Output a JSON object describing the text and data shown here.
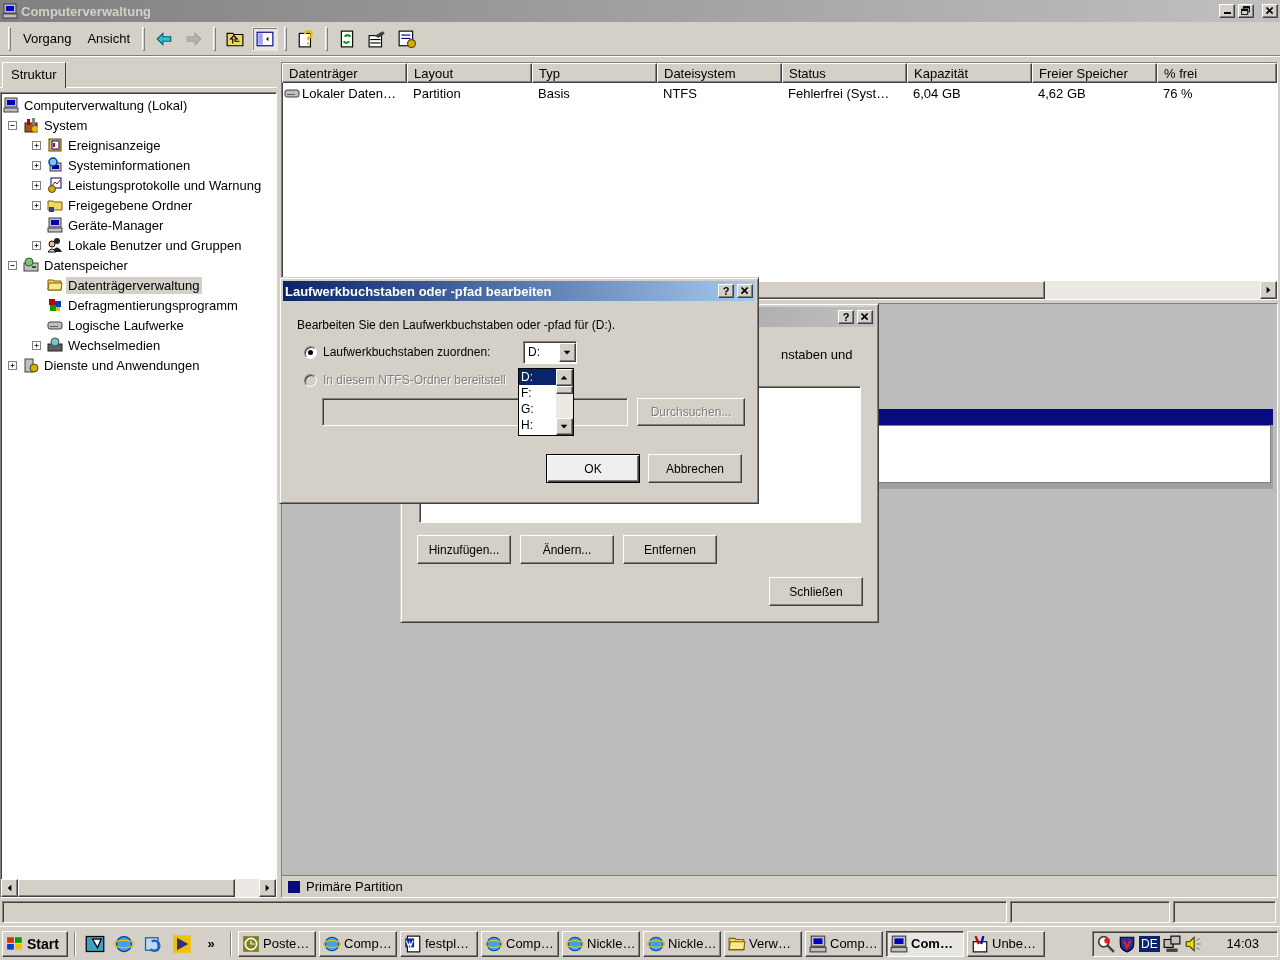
{
  "window": {
    "title": "Computerverwaltung"
  },
  "menu": [
    "Vorgang",
    "Ansicht"
  ],
  "toolbar_groups": [
    [
      {
        "kind": "back",
        "disabled": false,
        "pressed": false
      },
      {
        "kind": "forward",
        "disabled": true,
        "pressed": false
      }
    ],
    [
      {
        "kind": "up",
        "disabled": false,
        "pressed": false
      },
      {
        "kind": "tree",
        "disabled": false,
        "pressed": true
      }
    ],
    [
      {
        "kind": "help",
        "disabled": false,
        "pressed": false
      }
    ],
    [
      {
        "kind": "refresh",
        "disabled": false,
        "pressed": false
      },
      {
        "kind": "properties",
        "disabled": false,
        "pressed": false
      },
      {
        "kind": "export",
        "disabled": false,
        "pressed": false
      }
    ]
  ],
  "tabs": [
    {
      "label": "Struktur",
      "selected": true
    }
  ],
  "tree": [
    {
      "label": "Computerverwaltung (Lokal)",
      "kind": "computer",
      "selected": false,
      "children": [
        {
          "label": "System",
          "kind": "tools",
          "expanded": true,
          "selected": false,
          "children": [
            {
              "label": "Ereignisanzeige",
              "kind": "eventlog",
              "expanded": false,
              "selected": false
            },
            {
              "label": "Systeminformationen",
              "kind": "sysinfo",
              "expanded": false,
              "selected": false
            },
            {
              "label": "Leistungsprotokolle und Warnung",
              "kind": "perf",
              "expanded": false,
              "selected": false
            },
            {
              "label": "Freigegebene Ordner",
              "kind": "shared",
              "expanded": false,
              "selected": false
            },
            {
              "label": "Geräte-Manager",
              "kind": "computer",
              "selected": false
            },
            {
              "label": "Lokale Benutzer und Gruppen",
              "kind": "users",
              "expanded": false,
              "selected": false
            }
          ]
        },
        {
          "label": "Datenspeicher",
          "kind": "storage",
          "expanded": true,
          "selected": false,
          "children": [
            {
              "label": "Datenträgerverwaltung",
              "kind": "folder",
              "selected": true
            },
            {
              "label": "Defragmentierungsprogramm",
              "kind": "defrag",
              "selected": false
            },
            {
              "label": "Logische Laufwerke",
              "kind": "drive",
              "selected": false
            },
            {
              "label": "Wechselmedien",
              "kind": "media",
              "expanded": false,
              "selected": false
            }
          ]
        },
        {
          "label": "Dienste und Anwendungen",
          "kind": "services",
          "expanded": false,
          "selected": false
        }
      ]
    }
  ],
  "table": {
    "columns": [
      "Datenträger",
      "Layout",
      "Typ",
      "Dateisystem",
      "Status",
      "Kapazität",
      "Freier Speicher",
      "% frei"
    ],
    "rows": [
      {
        "cells": [
          "Lokaler Daten…",
          "Partition",
          "Basis",
          "NTFS",
          "Fehlerfrei (Syst…",
          "6,04 GB",
          "4,62 GB",
          "76 %"
        ]
      }
    ]
  },
  "legend": [
    {
      "label": "Primäre Partition",
      "color": "#0a0a80"
    }
  ],
  "back_dialog": {
    "help_glyph": "?",
    "text_fragment": "nstaben und",
    "buttons": [
      "Hinzufügen...",
      "Ändern...",
      "Entfernen"
    ],
    "close_button": "Schließen"
  },
  "dialog": {
    "title": "Laufwerkbuchstaben oder -pfad bearbeiten",
    "help_glyph": "?",
    "prompt": "Bearbeiten Sie den Laufwerkbuchstaben oder -pfad für  (D:).",
    "options": [
      {
        "label": "Laufwerkbuchstaben zuordnen:",
        "selected": true,
        "disabled": false
      },
      {
        "label": "In diesem NTFS-Ordner bereitstell",
        "selected": false,
        "disabled": true
      }
    ],
    "drive_value": "D:",
    "drive_list": [
      {
        "label": "D:",
        "selected": true
      },
      {
        "label": "F:",
        "selected": false
      },
      {
        "label": "G:",
        "selected": false
      },
      {
        "label": "H:",
        "selected": false
      }
    ],
    "browse_button": {
      "label": "Durchsuchen...",
      "disabled": true
    },
    "buttons": [
      {
        "label": "OK",
        "default": true
      },
      {
        "label": "Abbrechen",
        "default": false
      }
    ]
  },
  "taskbar": {
    "start": "Start",
    "more": "»",
    "tasks": [
      {
        "label": "Poste…",
        "kind": "clock",
        "selected": false
      },
      {
        "label": "Comp…",
        "kind": "ie",
        "selected": false
      },
      {
        "label": "festpl…",
        "kind": "word",
        "selected": false
      },
      {
        "label": "Comp…",
        "kind": "ie",
        "selected": false
      },
      {
        "label": "Nickle…",
        "kind": "ie",
        "selected": false
      },
      {
        "label": "Nickle…",
        "kind": "ie",
        "selected": false
      },
      {
        "label": "Verw…",
        "kind": "folder",
        "selected": false
      },
      {
        "label": "Comp…",
        "kind": "computer",
        "selected": false
      },
      {
        "label": "Com…",
        "kind": "computer",
        "selected": true
      },
      {
        "label": "Unbe…",
        "kind": "paint",
        "selected": false
      }
    ],
    "tray_language": "DE",
    "clock": "14:03"
  }
}
